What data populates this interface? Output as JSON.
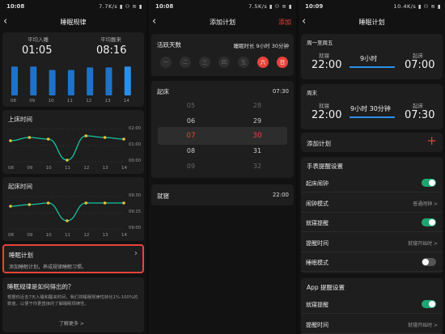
{
  "colors": {
    "accent_red": "#e8433a",
    "teal": "#1ea672",
    "bar_blue": "#1e73c8",
    "bar_blue_hi": "#2a8fe8",
    "line_green": "#16c4a0",
    "dot_yellow": "#e6c23a"
  },
  "p1": {
    "status": {
      "time": "10:08",
      "icons": "7.7K/s ▮ ⚇ ≋ ▮"
    },
    "title": "睡眠规律",
    "avg_sleep_label": "平均入睡",
    "avg_sleep": "01:05",
    "avg_wake_label": "平均醒来",
    "avg_wake": "08:16",
    "bar_days": [
      "08",
      "09",
      "10",
      "11",
      "12",
      "13",
      "14"
    ],
    "chart_bars": {
      "type": "bar",
      "categories": [
        "08",
        "09",
        "10",
        "11",
        "12",
        "13",
        "14"
      ],
      "values": [
        34,
        34,
        30,
        30,
        33,
        33,
        34
      ],
      "highlight_index": 6
    },
    "wake_title": "上床时间",
    "wake_y_labels": [
      "02:00",
      "01:00",
      "00:00"
    ],
    "wake_x_labels": [
      "08",
      "09",
      "10",
      "11",
      "12",
      "13",
      "14"
    ],
    "chart_bed": {
      "type": "line",
      "x": [
        "08",
        "09",
        "10",
        "11",
        "12",
        "13",
        "14"
      ],
      "y": [
        0.65,
        0.75,
        0.7,
        0.05,
        0.8,
        0.75,
        0.7
      ]
    },
    "rise_title": "起床时间",
    "rise_y_labels": [
      "09:30",
      "09:15",
      "09:00"
    ],
    "rise_x_labels": [
      "08",
      "09",
      "10",
      "11",
      "12",
      "13",
      "14"
    ],
    "chart_rise": {
      "type": "line",
      "x": [
        "08",
        "09",
        "10",
        "11",
        "12",
        "13",
        "14"
      ],
      "y": [
        0.7,
        0.75,
        0.8,
        0.25,
        0.8,
        0.8,
        0.8
      ]
    },
    "plan_title": "睡眠计划",
    "plan_desc": "添加睡眠计划，养成规律睡眠习惯。",
    "faq_title": "睡眠规律是如何得出的？",
    "faq_text": "根据你近去7天入睡和醒来时间，我们将睡眠规律性转化1%-100%的数值，以便于你更直接的了解睡眠规律性。",
    "learn_more": "了解更多 >"
  },
  "p2": {
    "status": {
      "time": "10:08",
      "icons": "7.5K/s ▮ ⚇ ≋ ▮"
    },
    "title": "添加计划",
    "action": "添加",
    "active_days_label": "活跃天数",
    "duration_text": "睡眠时长 9小时 30分钟",
    "days": [
      {
        "label": "一",
        "on": false
      },
      {
        "label": "二",
        "on": false
      },
      {
        "label": "三",
        "on": false
      },
      {
        "label": "四",
        "on": false
      },
      {
        "label": "五",
        "on": false
      },
      {
        "label": "六",
        "on": true
      },
      {
        "label": "日",
        "on": true
      }
    ],
    "wake_label": "起床",
    "wake_value": "07:30",
    "hours": [
      "05",
      "06",
      "07",
      "08",
      "09"
    ],
    "minutes": [
      "28",
      "29",
      "30",
      "31",
      "32"
    ],
    "sleep_label": "就寝",
    "sleep_value": "22:00"
  },
  "p3": {
    "status": {
      "time": "10:09",
      "icons": "10.4K/s ▮ ⚇ ≋ ▮"
    },
    "title": "睡眠计划",
    "weekday_label": "周一至周五",
    "wd_bed_label": "就寝",
    "wd_bed": "22:00",
    "wd_dur": "9小时",
    "wd_wake_label": "起床",
    "wd_wake": "07:00",
    "weekend_label": "周末",
    "we_bed_label": "就寝",
    "we_bed": "22:00",
    "we_dur": "9小时 30分钟",
    "we_wake_label": "起床",
    "we_wake": "07:30",
    "add_plan": "添加计划",
    "watch_section": "手表提醒设置",
    "rows": [
      {
        "label": "起床闹钟",
        "value": "",
        "toggle": "on"
      },
      {
        "label": "闹钟模式",
        "value": "普通闹钟 >",
        "toggle": ""
      },
      {
        "label": "就寝提醒",
        "value": "",
        "toggle": "on"
      },
      {
        "label": "提醒时间",
        "value": "就寝开始时 >",
        "toggle": ""
      },
      {
        "label": "睡眠模式",
        "value": "",
        "toggle": "off"
      }
    ],
    "app_section": "App 提醒设置",
    "app_rows": [
      {
        "label": "就寝提醒",
        "value": "",
        "toggle": "on"
      },
      {
        "label": "提醒时间",
        "value": "就寝开始时 >",
        "toggle": ""
      }
    ]
  }
}
